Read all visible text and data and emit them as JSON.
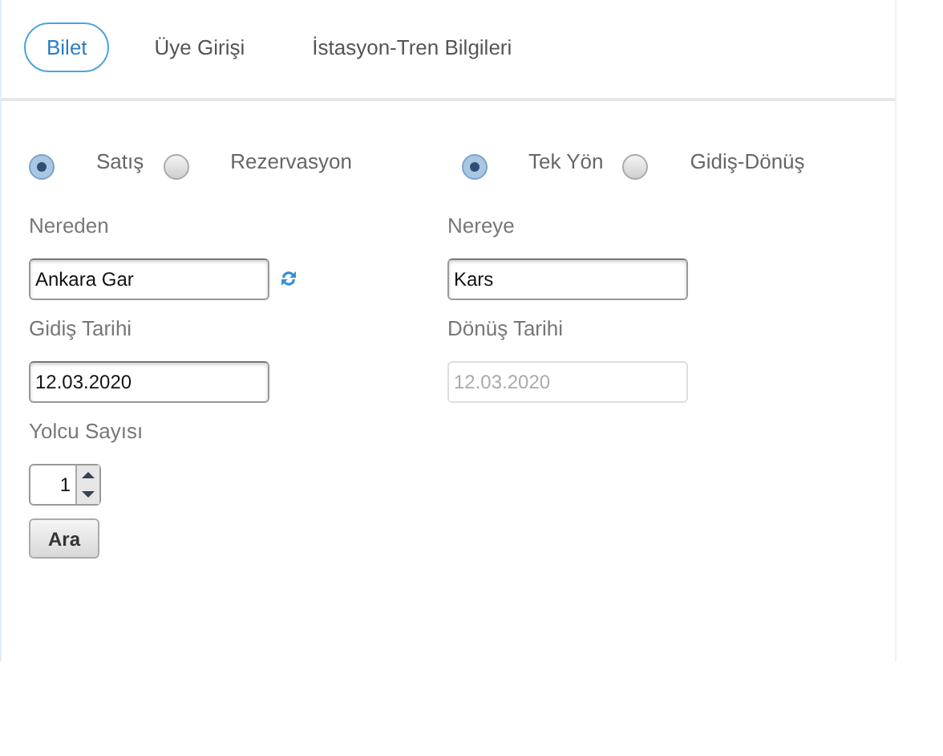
{
  "tabs": [
    {
      "label": "Bilet",
      "selected": true
    },
    {
      "label": "Üye Girişi",
      "selected": false
    },
    {
      "label": "İstasyon-Tren Bilgileri",
      "selected": false
    }
  ],
  "radio_groups": [
    [
      {
        "label": "Satış",
        "selected": true
      },
      {
        "label": "Rezervasyon",
        "selected": false
      }
    ],
    [
      {
        "label": "Tek Yön",
        "selected": true
      },
      {
        "label": "Gidiş-Dönüş",
        "selected": false
      }
    ]
  ],
  "from": {
    "label": "Nereden",
    "value": "Ankara Gar"
  },
  "to": {
    "label": "Nereye",
    "value": "Kars"
  },
  "departure_date": {
    "label": "Gidiş Tarihi",
    "value": "12.03.2020",
    "disabled": false
  },
  "return_date": {
    "label": "Dönüş Tarihi",
    "value": "12.03.2020",
    "disabled": true
  },
  "passengers": {
    "label": "Yolcu Sayısı",
    "value": "1"
  },
  "search_button": "Ara"
}
